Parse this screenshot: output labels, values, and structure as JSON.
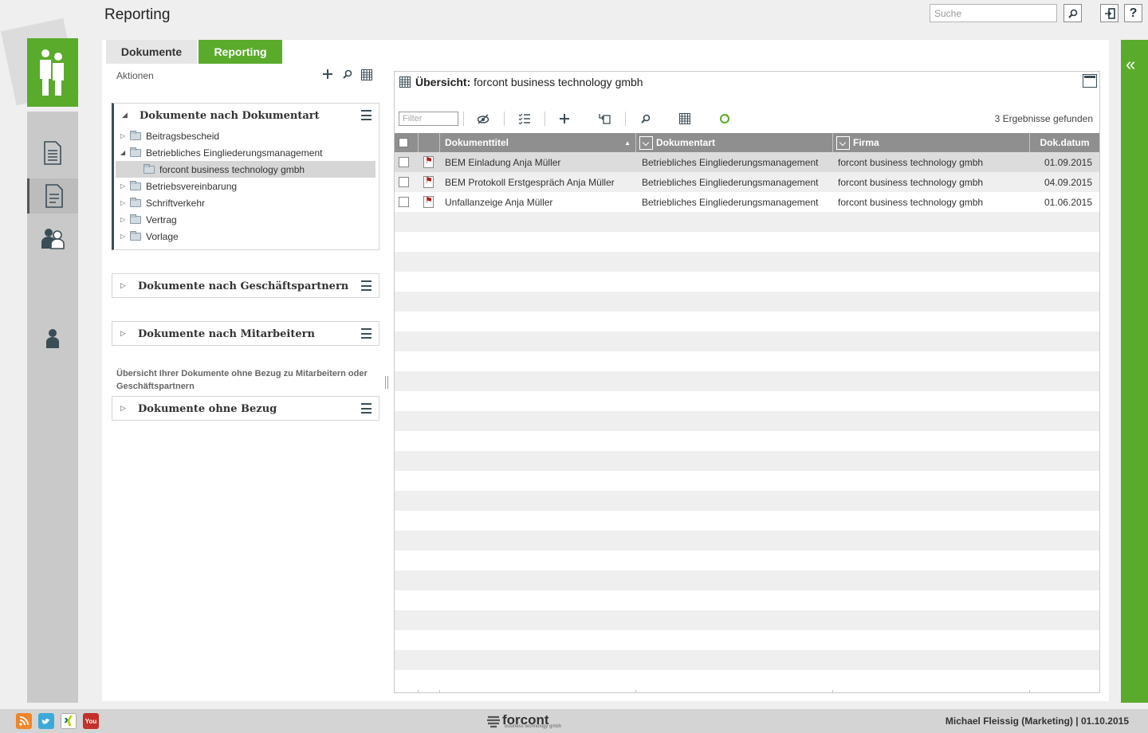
{
  "header": {
    "title": "Reporting",
    "search_placeholder": "Suche",
    "help_label": "?"
  },
  "tabs": [
    {
      "label": "Dokumente"
    },
    {
      "label": "Reporting"
    }
  ],
  "actions": {
    "label": "Aktionen"
  },
  "sections": {
    "dokumentart": {
      "title": "Dokumente nach Dokumentart",
      "items": [
        {
          "label": "Beitragsbescheid"
        },
        {
          "label": "Betriebliches Eingliederungsmanagement"
        },
        {
          "label": "forcont business technology gmbh"
        },
        {
          "label": "Betriebsvereinbarung"
        },
        {
          "label": "Schriftverkehr"
        },
        {
          "label": "Vertrag"
        },
        {
          "label": "Vorlage"
        }
      ]
    },
    "geschaeftspartner": {
      "title": "Dokumente nach Geschäftspartnern"
    },
    "mitarbeiter": {
      "title": "Dokumente nach Mitarbeitern"
    },
    "ohne_bezug_hint": "Übersicht Ihrer Dokumente ohne Bezug zu Mitarbeitern oder Geschäftspartnern",
    "ohne_bezug": {
      "title": "Dokumente ohne Bezug"
    }
  },
  "overview": {
    "title_bold": "Übersicht:",
    "title_rest": "forcont business technology gmbh",
    "filter_placeholder": "Filter",
    "result_count": "3 Ergebnisse gefunden",
    "columns": {
      "title": "Dokumenttitel",
      "type": "Dokumentart",
      "company": "Firma",
      "date": "Dok.datum"
    },
    "rows": [
      {
        "title": "BEM Einladung Anja Müller",
        "type": "Betriebliches Eingliederungsmanagement",
        "company": "forcont business technology gmbh",
        "date": "01.09.2015"
      },
      {
        "title": "BEM Protokoll Erstgespräch Anja Müller",
        "type": "Betriebliches Eingliederungsmanagement",
        "company": "forcont business technology gmbh",
        "date": "04.09.2015"
      },
      {
        "title": "Unfallanzeige Anja Müller",
        "type": "Betriebliches Eingliederungsmanagement",
        "company": "forcont business technology gmbh",
        "date": "01.06.2015"
      }
    ]
  },
  "footer": {
    "brand": "forcont",
    "brand_sub": "business technology gmbh",
    "user": "Michael Fleissig (Marketing)  |  01.10.2015",
    "social": [
      "rss-icon",
      "twitter-icon",
      "xing-icon",
      "youtube-icon"
    ],
    "youtube_text": "You"
  },
  "colors": {
    "accent": "#5aab2c",
    "dark": "#3b4d57",
    "grid_header": "#8f8f8f"
  }
}
